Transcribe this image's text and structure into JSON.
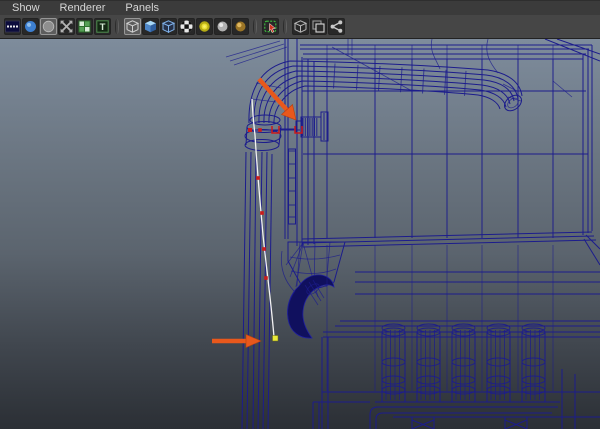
{
  "menu_bar": {
    "items": [
      {
        "label": "Show"
      },
      {
        "label": "Renderer"
      },
      {
        "label": "Panels"
      }
    ]
  },
  "toolbar": {
    "icons": [
      {
        "name": "film-gate",
        "active": false
      },
      {
        "name": "shaded-sphere",
        "active": false
      },
      {
        "name": "flat-circle",
        "active": true
      },
      {
        "name": "four-way-arrows",
        "active": false
      },
      {
        "name": "field-chart",
        "active": false
      },
      {
        "name": "text-annotation",
        "active": false
      },
      {
        "name": "wireframe-cube",
        "active": true
      },
      {
        "name": "smooth-shaded-cube",
        "active": false
      },
      {
        "name": "bounding-box-cube",
        "active": false
      },
      {
        "name": "textured-checker",
        "active": false
      },
      {
        "name": "use-all-lights",
        "active": false
      },
      {
        "name": "default-lighting",
        "active": false
      },
      {
        "name": "gold-material-light",
        "active": false
      },
      {
        "name": "isolate-select",
        "active": false
      },
      {
        "name": "xray-cube",
        "active": false
      },
      {
        "name": "xray-overlay",
        "active": false
      },
      {
        "name": "share-nodes",
        "active": false
      }
    ]
  },
  "viewport": {
    "mode": "wireframe",
    "background_top": "#7e8c9c",
    "background_mid": "#5b646e",
    "background_bottom": "#2b2f35",
    "wireframe_color": "#1c1c8c",
    "annotations": {
      "arrow_color": "#e8581c",
      "arrows": [
        {
          "name": "arrow-upper",
          "direction": "down-right"
        },
        {
          "name": "arrow-lower",
          "direction": "right"
        }
      ],
      "curve_color": "#f2f2f2",
      "cv_marker_color": "#cc1a1a",
      "selected_cv_color": "#e8e838"
    }
  }
}
